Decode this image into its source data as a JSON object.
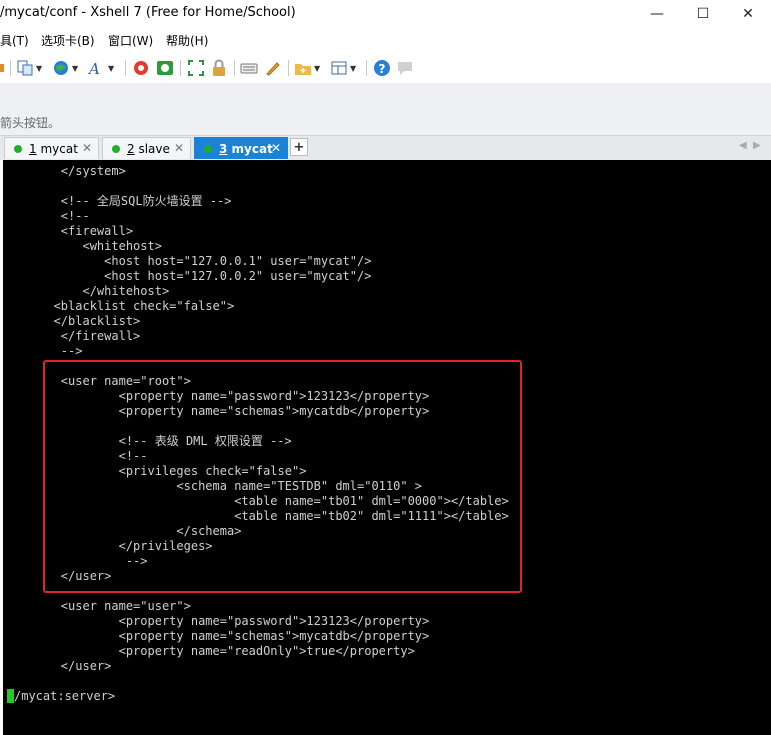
{
  "window": {
    "title": "/mycat/conf - Xshell 7 (Free for Home/School)",
    "minimize": "—",
    "maximize": "☐",
    "close": "✕"
  },
  "menu": [
    "具(T)",
    "选项卡(B)",
    "窗口(W)",
    "帮助(H)"
  ],
  "toolbar_icons": [
    "transfer-icon",
    "globe-icon",
    "font-icon",
    "xftp-icon",
    "xshell-green-icon",
    "fullscreen-icon",
    "lock-icon",
    "keyboard-icon",
    "pen-icon",
    "new-folder-icon",
    "layout-icon",
    "help-icon",
    "chat-icon"
  ],
  "hint": "箭头按钮。",
  "tabs": [
    {
      "num": "1",
      "label": " mycat",
      "active": false
    },
    {
      "num": "2",
      "label": " slave",
      "active": false
    },
    {
      "num": "3",
      "label": " mycat",
      "active": true
    }
  ],
  "tab_add": "+",
  "tab_nav_left": "◀",
  "tab_nav_right": "▶",
  "colors": {
    "active_tab": "#1b83d6",
    "terminal_bg": "#000000",
    "terminal_fg": "#d0d0d0",
    "highlight": "#e0252a",
    "session_dot": "#1fae29",
    "cursor": "#22cc22"
  },
  "terminal": {
    "lines": [
      "        </system>",
      "",
      "        <!-- 全局SQL防火墙设置 -->",
      "        <!--",
      "        <firewall>",
      "           <whitehost>",
      "              <host host=\"127.0.0.1\" user=\"mycat\"/>",
      "              <host host=\"127.0.0.2\" user=\"mycat\"/>",
      "           </whitehost>",
      "       <blacklist check=\"false\">",
      "       </blacklist>",
      "        </firewall>",
      "        -->",
      "",
      "        <user name=\"root\">",
      "                <property name=\"password\">123123</property>",
      "                <property name=\"schemas\">mycatdb</property>",
      "",
      "                <!-- 表级 DML 权限设置 -->",
      "                <!--",
      "                <privileges check=\"false\">",
      "                        <schema name=\"TESTDB\" dml=\"0110\" >",
      "                                <table name=\"tb01\" dml=\"0000\"></table>",
      "                                <table name=\"tb02\" dml=\"1111\"></table>",
      "                        </schema>",
      "                </privileges>",
      "                 -->",
      "        </user>",
      "",
      "        <user name=\"user\">",
      "                <property name=\"password\">123123</property>",
      "                <property name=\"schemas\">mycatdb</property>",
      "                <property name=\"readOnly\">true</property>",
      "        </user>",
      "",
      "/mycat:server>"
    ]
  }
}
